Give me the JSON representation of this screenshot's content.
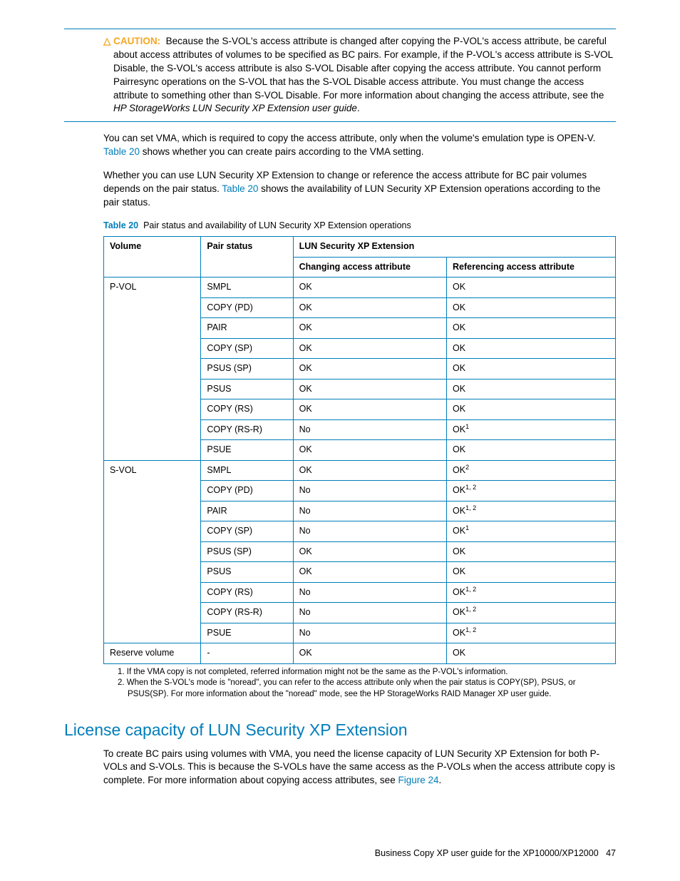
{
  "caution": {
    "icon": "△",
    "label": "CAUTION:",
    "body": "Because the S-VOL's access attribute is changed after copying the P-VOL's access attribute, be careful about access attributes of volumes to be specified as BC pairs. For example, if the P-VOL's access attribute is S-VOL Disable, the S-VOL's access attribute is also S-VOL Disable after copying the access attribute. You cannot perform Pairresync operations on the S-VOL that has the S-VOL Disable access attribute. You must change the access attribute to something other than S-VOL Disable. For more information about changing the access attribute, see the ",
    "italic_ref": "HP StorageWorks LUN Security XP Extension user guide"
  },
  "para1": {
    "a": "You can set VMA, which is required to copy the access attribute, only when the volume's emulation type is OPEN-V. ",
    "link": "Table 20",
    "b": " shows whether you can create pairs according to the VMA setting."
  },
  "para2": {
    "a": "Whether you can use LUN Security XP Extension to change or reference the access attribute for BC pair volumes depends on the pair status. ",
    "link": "Table 20",
    "b": " shows the availability of LUN Security XP Extension operations according to the pair status."
  },
  "table_caption": {
    "label": "Table 20",
    "text": "Pair status and availability of LUN Security XP Extension operations"
  },
  "table": {
    "headers": {
      "volume": "Volume",
      "pair_status": "Pair status",
      "lun_group": "LUN Security XP Extension",
      "changing": "Changing access attribute",
      "referencing": "Referencing access attribute"
    },
    "groups": [
      {
        "volume": "P-VOL",
        "rows": [
          {
            "status": "SMPL",
            "changing": "OK",
            "ref": "OK",
            "ref_sup": ""
          },
          {
            "status": "COPY (PD)",
            "changing": "OK",
            "ref": "OK",
            "ref_sup": ""
          },
          {
            "status": "PAIR",
            "changing": "OK",
            "ref": "OK",
            "ref_sup": ""
          },
          {
            "status": "COPY (SP)",
            "changing": "OK",
            "ref": "OK",
            "ref_sup": ""
          },
          {
            "status": "PSUS (SP)",
            "changing": "OK",
            "ref": "OK",
            "ref_sup": ""
          },
          {
            "status": "PSUS",
            "changing": "OK",
            "ref": "OK",
            "ref_sup": ""
          },
          {
            "status": "COPY (RS)",
            "changing": "OK",
            "ref": "OK",
            "ref_sup": ""
          },
          {
            "status": "COPY (RS-R)",
            "changing": "No",
            "ref": "OK",
            "ref_sup": "1"
          },
          {
            "status": "PSUE",
            "changing": "OK",
            "ref": "OK",
            "ref_sup": ""
          }
        ]
      },
      {
        "volume": "S-VOL",
        "rows": [
          {
            "status": "SMPL",
            "changing": "OK",
            "ref": "OK",
            "ref_sup": "2"
          },
          {
            "status": "COPY (PD)",
            "changing": "No",
            "ref": "OK",
            "ref_sup": "1, 2"
          },
          {
            "status": "PAIR",
            "changing": "No",
            "ref": "OK",
            "ref_sup": "1, 2"
          },
          {
            "status": "COPY (SP)",
            "changing": "No",
            "ref": "OK",
            "ref_sup": "1"
          },
          {
            "status": "PSUS (SP)",
            "changing": "OK",
            "ref": "OK",
            "ref_sup": ""
          },
          {
            "status": "PSUS",
            "changing": "OK",
            "ref": "OK",
            "ref_sup": ""
          },
          {
            "status": "COPY (RS)",
            "changing": "No",
            "ref": "OK",
            "ref_sup": "1, 2"
          },
          {
            "status": "COPY (RS-R)",
            "changing": "No",
            "ref": "OK",
            "ref_sup": "1, 2"
          },
          {
            "status": "PSUE",
            "changing": "No",
            "ref": "OK",
            "ref_sup": "1, 2"
          }
        ]
      },
      {
        "volume": "Reserve volume",
        "rows": [
          {
            "status": "-",
            "changing": "OK",
            "ref": "OK",
            "ref_sup": ""
          }
        ]
      }
    ]
  },
  "footnotes": {
    "f1": "1. If the VMA copy is not completed, referred information might not be the same as the P-VOL's information.",
    "f2": "2. When the S-VOL's mode is \"noread\", you can refer to the access attribute only when the pair status is COPY(SP), PSUS, or PSUS(SP). For more information about the \"noread\" mode, see the HP StorageWorks RAID Manager XP user guide."
  },
  "section_heading": "License capacity of LUN Security XP Extension",
  "section_para": {
    "a": "To create BC pairs using volumes with VMA, you need the license capacity of LUN Security XP Extension for both P-VOLs and S-VOLs. This is because the S-VOLs have the same access as the P-VOLs when the access attribute copy is complete. For more information about copying access attributes, see ",
    "link": "Figure 24",
    "b": "."
  },
  "footer": {
    "title": "Business Copy XP user guide for the XP10000/XP12000",
    "page": "47"
  }
}
